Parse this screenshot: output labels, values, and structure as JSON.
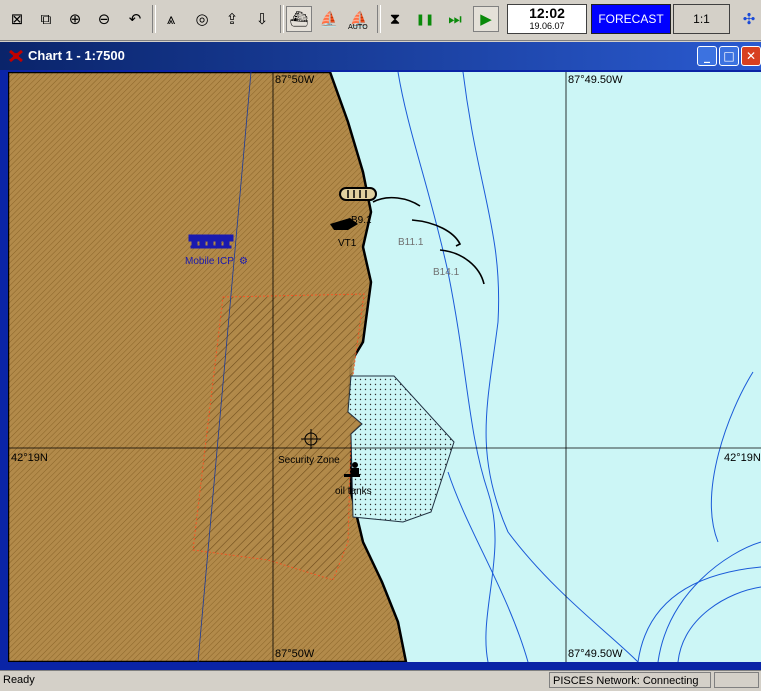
{
  "toolbar": {
    "tools": [
      {
        "name": "select-icon",
        "glyph": "⊠"
      },
      {
        "name": "zoom-window-icon",
        "glyph": "⧉"
      },
      {
        "name": "zoom-in-icon",
        "glyph": "⊕"
      },
      {
        "name": "zoom-out-icon",
        "glyph": "⊖"
      },
      {
        "name": "undo-view-icon",
        "glyph": "↶"
      },
      {
        "name": "compass-icon",
        "glyph": "⩓"
      },
      {
        "name": "target-icon",
        "glyph": "◎"
      },
      {
        "name": "export-icon",
        "glyph": "⇪"
      },
      {
        "name": "import-icon",
        "glyph": "⇩"
      },
      {
        "name": "ship-view-icon",
        "glyph": "⛴"
      },
      {
        "name": "boat-icon",
        "glyph": "⛵"
      },
      {
        "name": "auto-icon",
        "glyph": "⛵"
      },
      {
        "name": "stop-icon",
        "glyph": "⧗"
      },
      {
        "name": "pause-icon",
        "glyph": "❚❚"
      },
      {
        "name": "fast-forward-icon",
        "glyph": "⏭"
      },
      {
        "name": "play-icon",
        "glyph": "▶"
      }
    ],
    "auto_label": "AUTO",
    "clock_time": "12:02",
    "clock_date": "19.06.07",
    "forecast_label": "FORECAST",
    "scale_label": "1:1"
  },
  "window": {
    "title": "Chart 1 - 1:7500",
    "minimize": "_",
    "maximize": "□",
    "close": "✕"
  },
  "chart": {
    "colors": {
      "land": "#b28a4a",
      "water": "#ccf6f6",
      "contour": "#1a5ad8",
      "grid": "#000000",
      "zone_border": "#ff5020"
    },
    "lon_labels": {
      "left_top": "87°50W",
      "right_top": "87°49.50W",
      "left_bottom": "87°50W",
      "right_bottom": "87°49.50W"
    },
    "lat_labels": {
      "left": "42°19N",
      "right": "42°19N"
    },
    "features": {
      "mobile_icp": "Mobile ICP",
      "vt1": "VT1",
      "b9": "B9.1",
      "b11": "B11.1",
      "b14": "B14.1",
      "security_zone": "Security Zone",
      "oil_tanks": "oil tanks"
    }
  },
  "status": {
    "ready": "Ready",
    "network": "PISCES Network: Connecting"
  }
}
